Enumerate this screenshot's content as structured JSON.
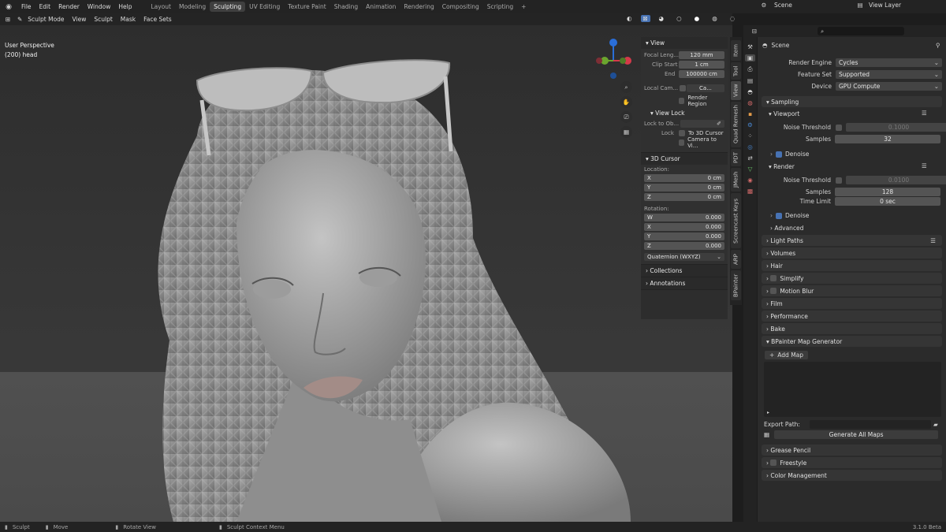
{
  "topbar": {
    "menu": [
      "File",
      "Edit",
      "Render",
      "Window",
      "Help"
    ],
    "workspaces": [
      "Layout",
      "Modeling",
      "Sculpting",
      "UV Editing",
      "Texture Paint",
      "Shading",
      "Animation",
      "Rendering",
      "Compositing",
      "Scripting"
    ],
    "active_workspace": "Sculpting",
    "plus": "+",
    "scene": "Scene",
    "view_layer": "View Layer"
  },
  "viewport_header": {
    "mode": "Sculpt Mode",
    "menus": [
      "View",
      "Sculpt",
      "Mask",
      "Face Sets"
    ]
  },
  "viewport": {
    "perspective": "User Perspective",
    "object": "(200) head"
  },
  "npanel": {
    "view_title": "View",
    "focal_label": "Focal Leng...",
    "focal_value": "120 mm",
    "clip_start_label": "Clip Start",
    "clip_start_value": "1 cm",
    "end_label": "End",
    "end_value": "100000 cm",
    "local_cam_label": "Local Cam...",
    "local_cam_value": "Ca...",
    "render_region": "Render Region",
    "view_lock_title": "View Lock",
    "lock_to_obj_label": "Lock to Ob...",
    "lock_label": "Lock",
    "to_3d_cursor": "To 3D Cursor",
    "camera_to_view": "Camera to Vi...",
    "cursor_title": "3D Cursor",
    "location_label": "Location:",
    "loc": [
      {
        "axis": "X",
        "value": "0 cm"
      },
      {
        "axis": "Y",
        "value": "0 cm"
      },
      {
        "axis": "Z",
        "value": "0 cm"
      }
    ],
    "rotation_label": "Rotation:",
    "rot": [
      {
        "axis": "W",
        "value": "0.000"
      },
      {
        "axis": "X",
        "value": "0.000"
      },
      {
        "axis": "Y",
        "value": "0.000"
      },
      {
        "axis": "Z",
        "value": "0.000"
      }
    ],
    "rotation_mode": "Quaternion (WXYZ)",
    "collections": "Collections",
    "annotations": "Annotations",
    "tabs": [
      "Item",
      "Tool",
      "View",
      "Quad Remesh",
      "PDT",
      "JMesh",
      "Screencast Keys",
      "ARP",
      "BPainter"
    ]
  },
  "properties": {
    "scene": "Scene",
    "render_engine_label": "Render Engine",
    "render_engine": "Cycles",
    "feature_set_label": "Feature Set",
    "feature_set": "Supported",
    "device_label": "Device",
    "device": "GPU Compute",
    "sampling": "Sampling",
    "viewport": "Viewport",
    "noise_threshold_label": "Noise Threshold",
    "vp_noise": "0.1000",
    "samples_label": "Samples",
    "vp_samples": "32",
    "denoise": "Denoise",
    "render": "Render",
    "r_noise": "0.0100",
    "r_samples": "128",
    "time_limit_label": "Time Limit",
    "time_limit": "0 sec",
    "advanced": "Advanced",
    "sections": [
      "Light Paths",
      "Volumes",
      "Hair",
      "Simplify",
      "Motion Blur",
      "Film",
      "Performance",
      "Bake",
      "BPainter Map Generator"
    ],
    "add_map": "Add Map",
    "export_path_label": "Export Path:",
    "generate_all": "Generate All Maps",
    "bottom_sections": [
      "Grease Pencil",
      "Freestyle",
      "Color Management"
    ]
  },
  "statusbar": {
    "sculpt": "Sculpt",
    "move": "Move",
    "rotate": "Rotate View",
    "context": "Sculpt Context Menu",
    "version": "3.1.0 Beta"
  }
}
